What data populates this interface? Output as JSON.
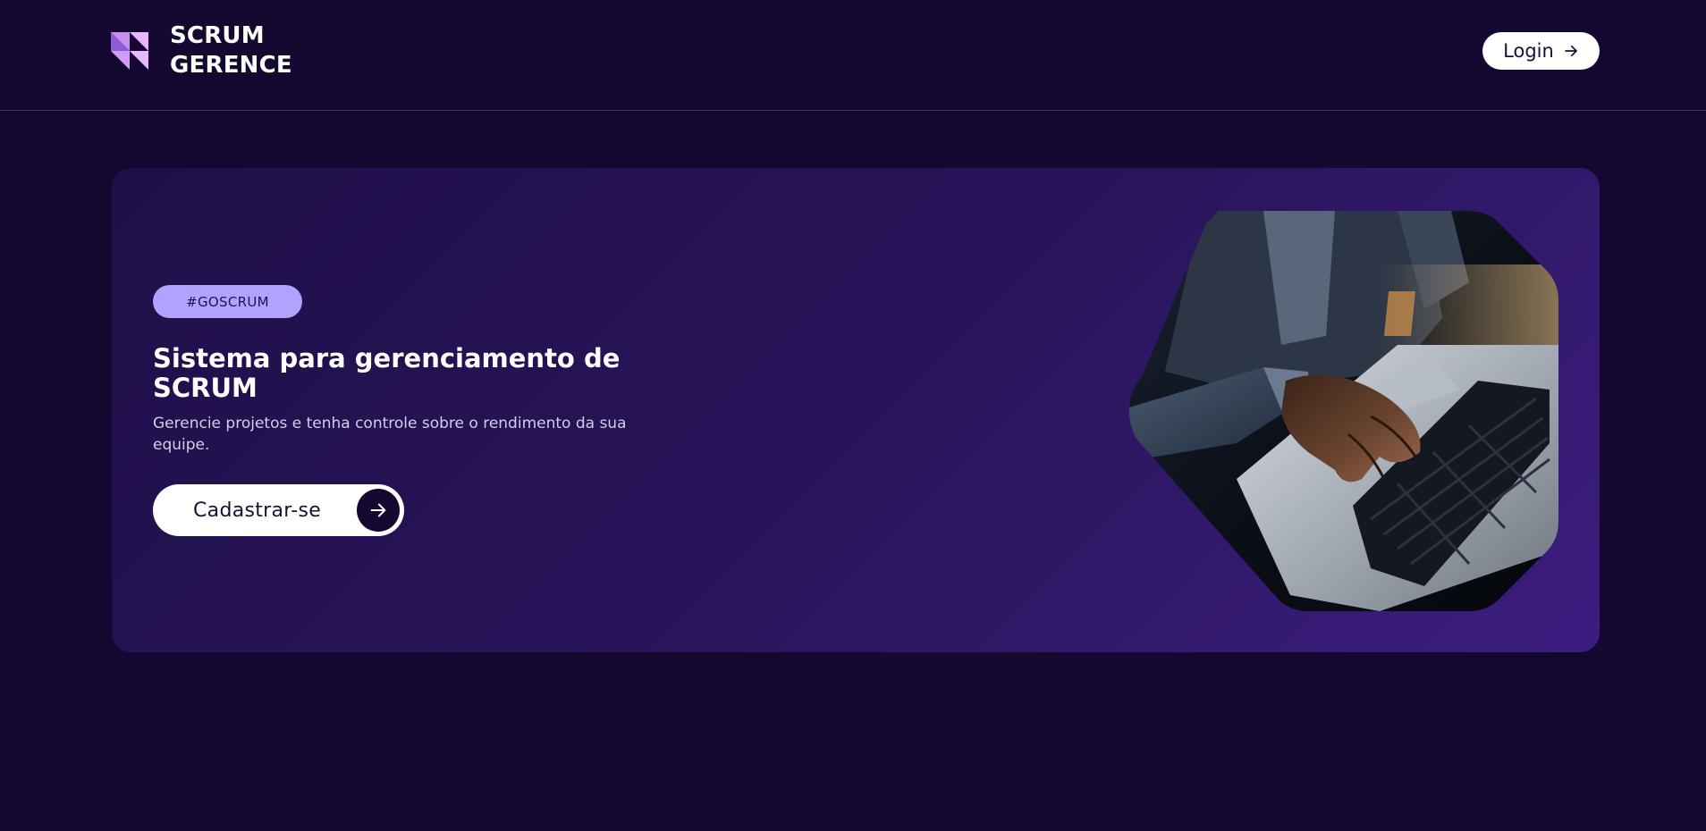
{
  "brand": {
    "line1": "SCRUM",
    "line2": "GERENCE",
    "logo_icon": "triangles-logo-icon",
    "logo_color": "#d9a8f5"
  },
  "header": {
    "login_label": "Login",
    "login_icon": "arrow-right-icon"
  },
  "hero": {
    "badge": "#GOSCRUM",
    "title": "Sistema para gerenciamento de SCRUM",
    "subtitle": "Gerencie projetos e tenha controle sobre o rendimento da sua equipe.",
    "signup_label": "Cadastrar-se",
    "signup_icon": "arrow-right-icon",
    "image": "laptop-typing-photo"
  },
  "colors": {
    "background": "#140830",
    "hero_gradient_start": "#1e0f48",
    "hero_gradient_end": "#3c1d80",
    "badge_bg": "#b3a1ff",
    "button_bg": "#ffffff"
  }
}
